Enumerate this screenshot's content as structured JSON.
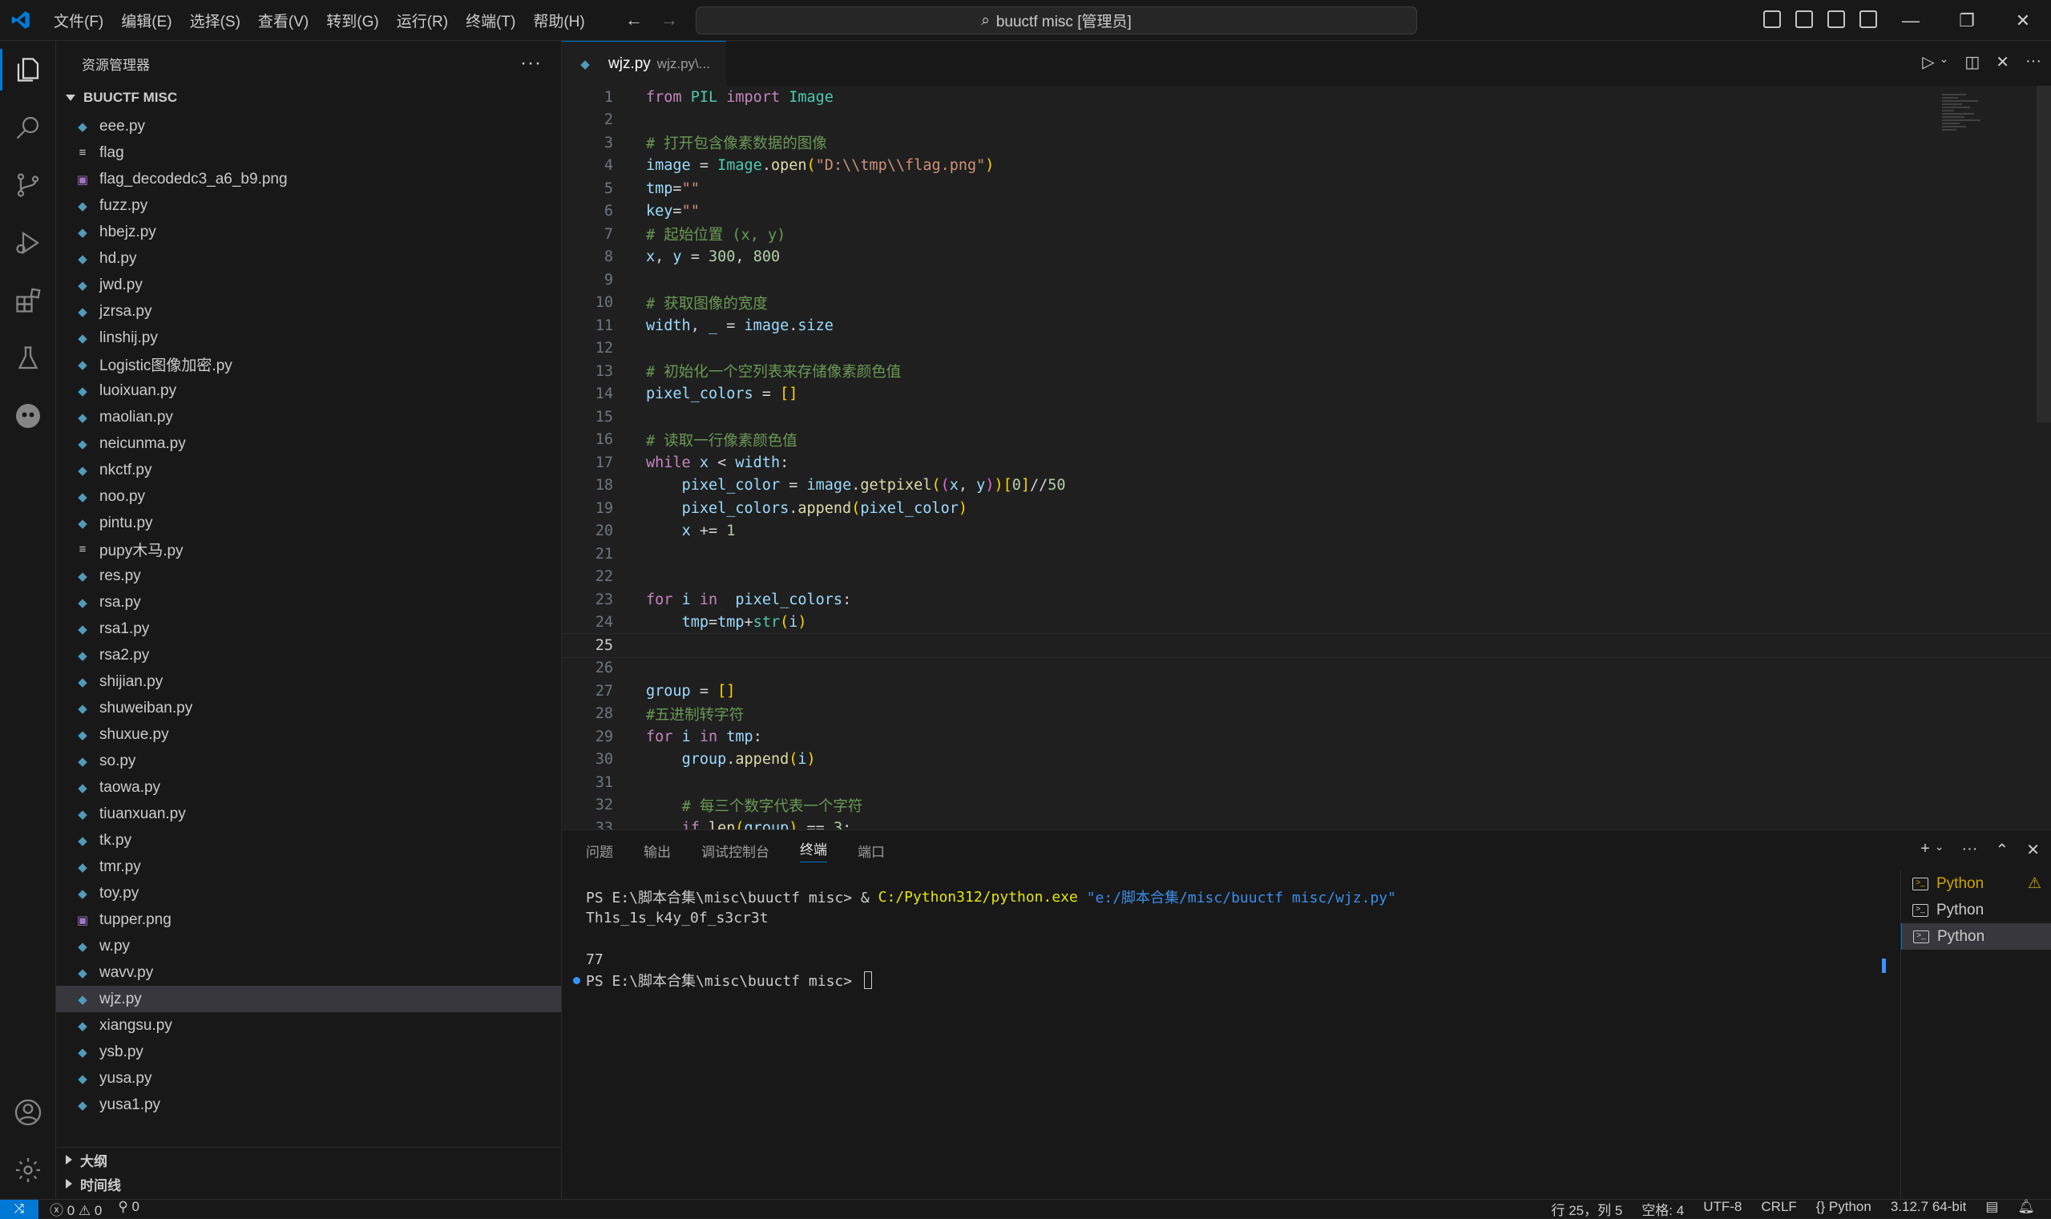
{
  "titlebar": {
    "menu": [
      "文件(F)",
      "编辑(E)",
      "选择(S)",
      "查看(V)",
      "转到(G)",
      "运行(R)",
      "终端(T)",
      "帮助(H)"
    ],
    "command_center": "buuctf misc [管理员]"
  },
  "sidebar": {
    "title": "资源管理器",
    "folder": "BUUCTF MISC",
    "files": [
      {
        "name": "eee.py",
        "type": "py"
      },
      {
        "name": "flag",
        "type": "txt"
      },
      {
        "name": "flag_decodedc3_a6_b9.png",
        "type": "img"
      },
      {
        "name": "fuzz.py",
        "type": "py"
      },
      {
        "name": "hbejz.py",
        "type": "py"
      },
      {
        "name": "hd.py",
        "type": "py"
      },
      {
        "name": "jwd.py",
        "type": "py"
      },
      {
        "name": "jzrsa.py",
        "type": "py"
      },
      {
        "name": "linshij.py",
        "type": "py"
      },
      {
        "name": "Logistic图像加密.py",
        "type": "py"
      },
      {
        "name": "luoixuan.py",
        "type": "py"
      },
      {
        "name": "maolian.py",
        "type": "py"
      },
      {
        "name": "neicunma.py",
        "type": "py"
      },
      {
        "name": "nkctf.py",
        "type": "py"
      },
      {
        "name": "noo.py",
        "type": "py"
      },
      {
        "name": "pintu.py",
        "type": "py"
      },
      {
        "name": "pupy木马.py",
        "type": "txt"
      },
      {
        "name": "res.py",
        "type": "py"
      },
      {
        "name": "rsa.py",
        "type": "py"
      },
      {
        "name": "rsa1.py",
        "type": "py"
      },
      {
        "name": "rsa2.py",
        "type": "py"
      },
      {
        "name": "shijian.py",
        "type": "py"
      },
      {
        "name": "shuweiban.py",
        "type": "py"
      },
      {
        "name": "shuxue.py",
        "type": "py"
      },
      {
        "name": "so.py",
        "type": "py"
      },
      {
        "name": "taowa.py",
        "type": "py"
      },
      {
        "name": "tiuanxuan.py",
        "type": "py"
      },
      {
        "name": "tk.py",
        "type": "py"
      },
      {
        "name": "tmr.py",
        "type": "py"
      },
      {
        "name": "toy.py",
        "type": "py"
      },
      {
        "name": "tupper.png",
        "type": "img"
      },
      {
        "name": "w.py",
        "type": "py"
      },
      {
        "name": "wavv.py",
        "type": "py"
      },
      {
        "name": "wjz.py",
        "type": "py",
        "selected": true
      },
      {
        "name": "xiangsu.py",
        "type": "py"
      },
      {
        "name": "ysb.py",
        "type": "py"
      },
      {
        "name": "yusa.py",
        "type": "py"
      },
      {
        "name": "yusa1.py",
        "type": "py"
      }
    ],
    "outline": "大纲",
    "timeline": "时间线"
  },
  "editor": {
    "tab_name": "wjz.py",
    "tab_desc": "wjz.py\\...",
    "current_line": 25,
    "lines": [
      [
        [
          "kw",
          "from"
        ],
        [
          "op",
          " "
        ],
        [
          "cls",
          "PIL"
        ],
        [
          "op",
          " "
        ],
        [
          "kw",
          "import"
        ],
        [
          "op",
          " "
        ],
        [
          "cls",
          "Image"
        ]
      ],
      [],
      [
        [
          "cmt",
          "# 打开包含像素数据的图像"
        ]
      ],
      [
        [
          "var",
          "image"
        ],
        [
          "op",
          " = "
        ],
        [
          "cls",
          "Image"
        ],
        [
          "op",
          "."
        ],
        [
          "fn",
          "open"
        ],
        [
          "br",
          "("
        ],
        [
          "str",
          "\"D:\\\\tmp\\\\flag.png\""
        ],
        [
          "br",
          ")"
        ]
      ],
      [
        [
          "var",
          "tmp"
        ],
        [
          "op",
          "="
        ],
        [
          "str",
          "\"\""
        ]
      ],
      [
        [
          "var",
          "key"
        ],
        [
          "op",
          "="
        ],
        [
          "str",
          "\"\""
        ]
      ],
      [
        [
          "cmt",
          "# 起始位置 (x, y)"
        ]
      ],
      [
        [
          "var",
          "x"
        ],
        [
          "op",
          ", "
        ],
        [
          "var",
          "y"
        ],
        [
          "op",
          " = "
        ],
        [
          "num",
          "300"
        ],
        [
          "op",
          ", "
        ],
        [
          "num",
          "800"
        ]
      ],
      [],
      [
        [
          "cmt",
          "# 获取图像的宽度"
        ]
      ],
      [
        [
          "var",
          "width"
        ],
        [
          "op",
          ", "
        ],
        [
          "var",
          "_"
        ],
        [
          "op",
          " = "
        ],
        [
          "var",
          "image"
        ],
        [
          "op",
          "."
        ],
        [
          "var",
          "size"
        ]
      ],
      [],
      [
        [
          "cmt",
          "# 初始化一个空列表来存储像素颜色值"
        ]
      ],
      [
        [
          "var",
          "pixel_colors"
        ],
        [
          "op",
          " = "
        ],
        [
          "br",
          "[]"
        ]
      ],
      [],
      [
        [
          "cmt",
          "# 读取一行像素颜色值"
        ]
      ],
      [
        [
          "kw",
          "while"
        ],
        [
          "op",
          " "
        ],
        [
          "var",
          "x"
        ],
        [
          "op",
          " < "
        ],
        [
          "var",
          "width"
        ],
        [
          "op",
          ":"
        ]
      ],
      [
        [
          "op",
          "    "
        ],
        [
          "var",
          "pixel_color"
        ],
        [
          "op",
          " = "
        ],
        [
          "var",
          "image"
        ],
        [
          "op",
          "."
        ],
        [
          "fn",
          "getpixel"
        ],
        [
          "br",
          "("
        ],
        [
          "br2",
          "("
        ],
        [
          "var",
          "x"
        ],
        [
          "op",
          ", "
        ],
        [
          "var",
          "y"
        ],
        [
          "br2",
          ")"
        ],
        [
          "br",
          ")"
        ],
        [
          "br",
          "["
        ],
        [
          "num",
          "0"
        ],
        [
          "br",
          "]"
        ],
        [
          "op",
          "//"
        ],
        [
          "num",
          "50"
        ]
      ],
      [
        [
          "op",
          "    "
        ],
        [
          "var",
          "pixel_colors"
        ],
        [
          "op",
          "."
        ],
        [
          "fn",
          "append"
        ],
        [
          "br",
          "("
        ],
        [
          "var",
          "pixel_color"
        ],
        [
          "br",
          ")"
        ]
      ],
      [
        [
          "op",
          "    "
        ],
        [
          "var",
          "x"
        ],
        [
          "op",
          " += "
        ],
        [
          "num",
          "1"
        ]
      ],
      [],
      [],
      [
        [
          "kw",
          "for"
        ],
        [
          "op",
          " "
        ],
        [
          "var",
          "i"
        ],
        [
          "op",
          " "
        ],
        [
          "kw",
          "in"
        ],
        [
          "op",
          "  "
        ],
        [
          "var",
          "pixel_colors"
        ],
        [
          "op",
          ":"
        ]
      ],
      [
        [
          "op",
          "    "
        ],
        [
          "var",
          "tmp"
        ],
        [
          "op",
          "="
        ],
        [
          "var",
          "tmp"
        ],
        [
          "op",
          "+"
        ],
        [
          "cls",
          "str"
        ],
        [
          "br",
          "("
        ],
        [
          "var",
          "i"
        ],
        [
          "br",
          ")"
        ]
      ],
      [],
      [],
      [
        [
          "var",
          "group"
        ],
        [
          "op",
          " = "
        ],
        [
          "br",
          "[]"
        ]
      ],
      [
        [
          "cmt",
          "#五进制转字符"
        ]
      ],
      [
        [
          "kw",
          "for"
        ],
        [
          "op",
          " "
        ],
        [
          "var",
          "i"
        ],
        [
          "op",
          " "
        ],
        [
          "kw",
          "in"
        ],
        [
          "op",
          " "
        ],
        [
          "var",
          "tmp"
        ],
        [
          "op",
          ":"
        ]
      ],
      [
        [
          "op",
          "    "
        ],
        [
          "var",
          "group"
        ],
        [
          "op",
          "."
        ],
        [
          "fn",
          "append"
        ],
        [
          "br",
          "("
        ],
        [
          "var",
          "i"
        ],
        [
          "br",
          ")"
        ]
      ],
      [],
      [
        [
          "op",
          "    "
        ],
        [
          "cmt",
          "# 每三个数字代表一个字符"
        ]
      ],
      [
        [
          "op",
          "    "
        ],
        [
          "kw",
          "if"
        ],
        [
          "op",
          " "
        ],
        [
          "fn",
          "len"
        ],
        [
          "br",
          "("
        ],
        [
          "var",
          "group"
        ],
        [
          "br",
          ")"
        ],
        [
          "op",
          " == "
        ],
        [
          "num",
          "3"
        ],
        [
          "op",
          ":"
        ]
      ]
    ]
  },
  "panel": {
    "tabs": [
      "问题",
      "输出",
      "调试控制台",
      "终端",
      "端口"
    ],
    "active_tab": "终端",
    "terminal": {
      "cmd_prompt": "PS E:\\脚本合集\\misc\\buuctf misc> & ",
      "cmd_exe": "C:/Python312/python.exe",
      "cmd_arg": "\"e:/脚本合集/misc/buuctf misc/wjz.py\"",
      "output1": "Th1s_1s_k4y_0f_s3cr3t",
      "output2": "77",
      "prompt": "PS E:\\脚本合集\\misc\\buuctf misc> "
    },
    "terminals": [
      "Python",
      "Python",
      "Python"
    ]
  },
  "statusbar": {
    "errors": "0",
    "warnings": "0",
    "ports": "0",
    "position": "行 25，列 5",
    "spaces": "空格: 4",
    "encoding": "UTF-8",
    "eol": "CRLF",
    "language": "Python",
    "interpreter": "3.12.7 64-bit"
  },
  "colors": {
    "accent": "#0078d4",
    "background": "#1f1f1f"
  }
}
